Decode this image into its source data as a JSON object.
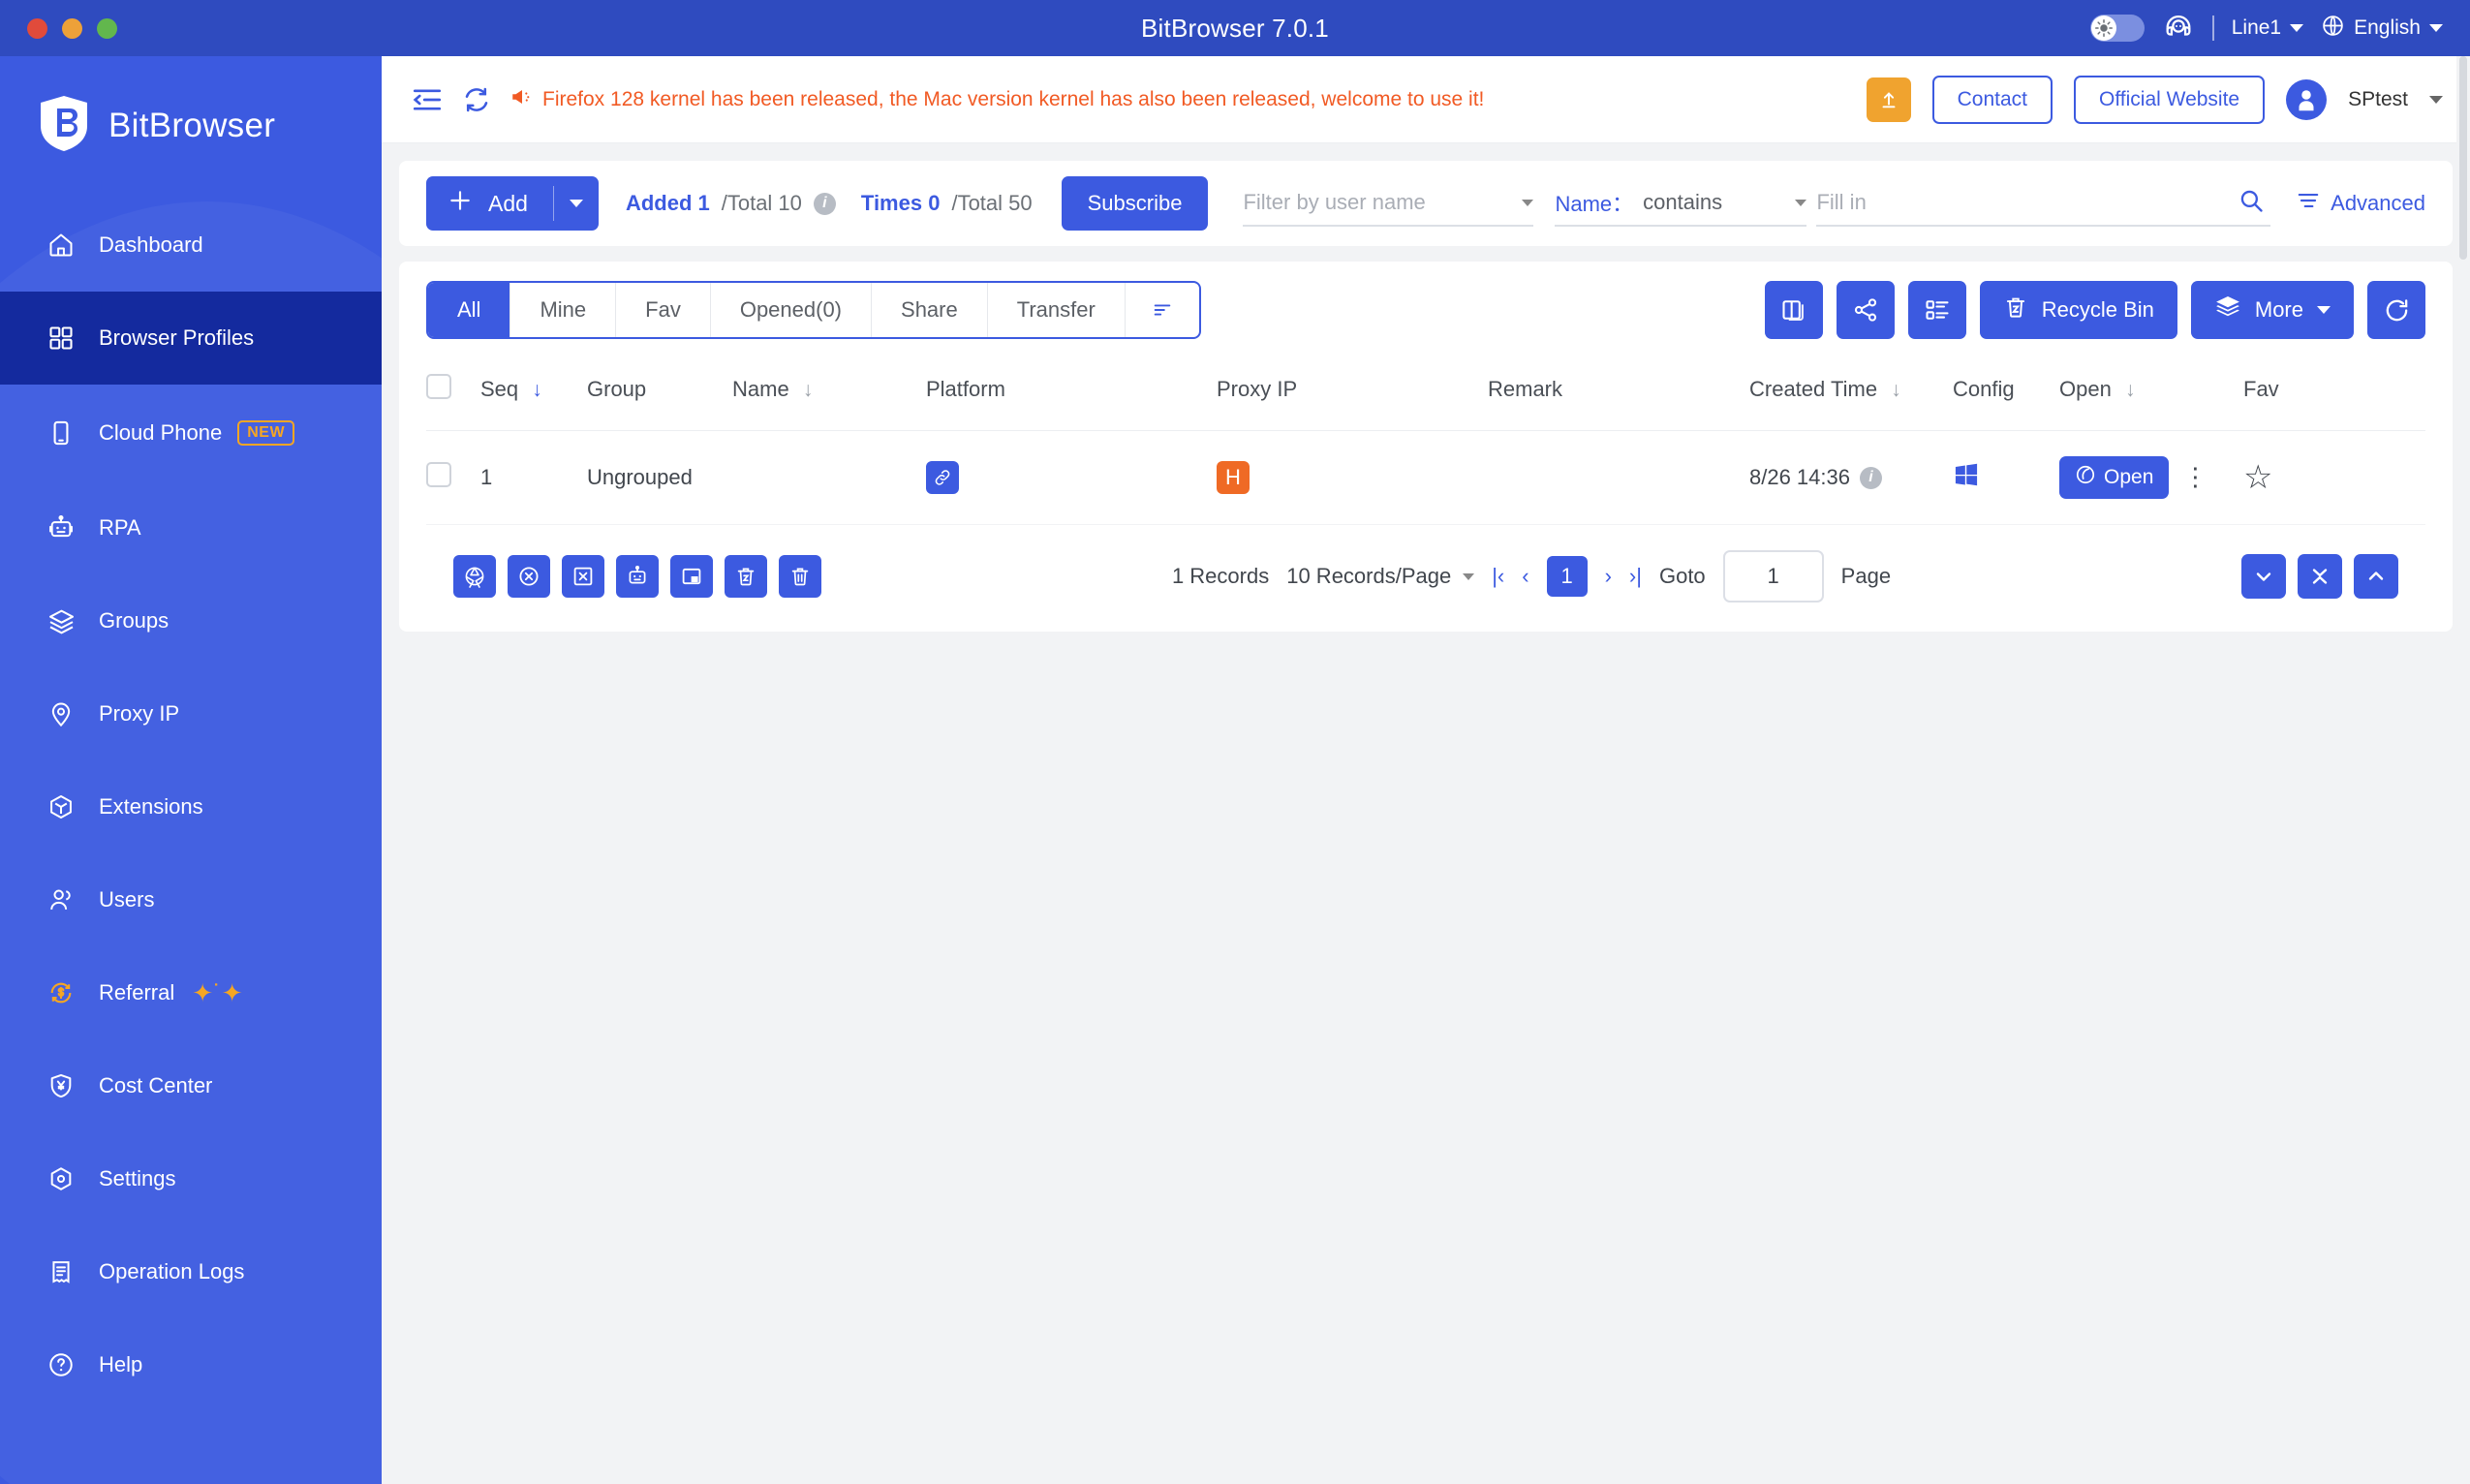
{
  "titlebar": {
    "app_title": "BitBrowser 7.0.1",
    "theme_toggle_icon": "sun-icon",
    "support_icon": "headset-chat-icon",
    "line_label": "Line1",
    "language_icon": "globe-icon",
    "language_label": "English",
    "window_buttons": [
      "close",
      "minimize",
      "maximize"
    ]
  },
  "sidebar": {
    "brand": "BitBrowser",
    "brand_icon": "bitbrowser-shield-logo",
    "items": [
      {
        "label": "Dashboard",
        "icon": "home-icon",
        "active": false
      },
      {
        "label": "Browser Profiles",
        "icon": "grid-icon",
        "active": true
      },
      {
        "label": "Cloud Phone",
        "icon": "mobile-phone-icon",
        "active": false,
        "badge": "NEW"
      },
      {
        "label": "RPA",
        "icon": "robot-icon",
        "active": false
      },
      {
        "label": "Groups",
        "icon": "layers-icon",
        "active": false
      },
      {
        "label": "Proxy IP",
        "icon": "location-pin-icon",
        "active": false
      },
      {
        "label": "Extensions",
        "icon": "hexagon-box-icon",
        "active": false
      },
      {
        "label": "Users",
        "icon": "user-group-icon",
        "active": false
      },
      {
        "label": "Referral",
        "icon": "dollar-refresh-icon",
        "active": false,
        "sparkle": true
      },
      {
        "label": "Cost Center",
        "icon": "shield-yen-icon",
        "active": false
      },
      {
        "label": "Settings",
        "icon": "hex-gear-icon",
        "active": false
      },
      {
        "label": "Operation Logs",
        "icon": "log-list-icon",
        "active": false
      },
      {
        "label": "Help",
        "icon": "question-circle-icon",
        "active": false
      }
    ]
  },
  "notice": {
    "collapse_icon": "collapse-sidebar-icon",
    "refresh_icon": "refresh-icon",
    "megaphone_icon": "megaphone-icon",
    "message": "Firefox 128 kernel has been released, the Mac version kernel has also been released, welcome to use it!",
    "upload_icon": "upload-icon",
    "contact_label": "Contact",
    "official_website_label": "Official Website",
    "avatar_icon": "user-avatar-icon",
    "user_name": "SPtest"
  },
  "toolbar": {
    "add_label": "Add",
    "add_icon": "plus-icon",
    "added_prefix": "Added 1",
    "added_suffix": "/Total 10",
    "times_prefix": "Times 0",
    "times_suffix": "/Total 50",
    "info_icon": "info-icon",
    "subscribe_label": "Subscribe",
    "user_filter_placeholder": "Filter by user name",
    "name_label": "Name：",
    "name_condition": "contains",
    "name_value_placeholder": "Fill in",
    "search_icon": "search-icon",
    "advanced_label": "Advanced",
    "advanced_icon": "filter-icon"
  },
  "tabs": [
    {
      "label": "All",
      "active": true
    },
    {
      "label": "Mine",
      "active": false
    },
    {
      "label": "Fav",
      "active": false
    },
    {
      "label": "Opened(0)",
      "active": false
    },
    {
      "label": "Share",
      "active": false
    },
    {
      "label": "Transfer",
      "active": false
    }
  ],
  "tab_sort_icon": "sort-icon",
  "actions": {
    "window_layout_icon": "window-layout-icon",
    "share_icon": "share-icon",
    "column_settings_icon": "list-settings-icon",
    "recycle_bin_label": "Recycle Bin",
    "recycle_bin_icon": "trash-restore-icon",
    "more_label": "More",
    "more_icon": "layers-icon",
    "refresh_icon": "refresh-circle-icon"
  },
  "table": {
    "columns": [
      {
        "label": "Seq",
        "sortable": true,
        "sort_active": true
      },
      {
        "label": "Group",
        "sortable": false
      },
      {
        "label": "Name",
        "sortable": true
      },
      {
        "label": "Platform",
        "sortable": false
      },
      {
        "label": "Proxy IP",
        "sortable": false
      },
      {
        "label": "Remark",
        "sortable": false
      },
      {
        "label": "Created Time",
        "sortable": true
      },
      {
        "label": "Config",
        "sortable": false
      },
      {
        "label": "Open",
        "sortable": true
      },
      {
        "label": "Fav",
        "sortable": false
      }
    ],
    "rows": [
      {
        "seq": "1",
        "group": "Ungrouped",
        "name": "",
        "platform_icon": "link-icon",
        "proxy_ip_badge": "H",
        "remark": "",
        "created_time": "8/26 14:36",
        "created_time_info_icon": "info-icon",
        "config_icon": "windows-icon",
        "open_label": "Open",
        "open_icon": "bit-browser-icon",
        "more_icon": "kebab-menu-icon",
        "fav_icon": "star-outline-icon"
      }
    ]
  },
  "footer": {
    "mini_buttons": [
      "fingerprint-icon",
      "close-circle-icon",
      "close-box-icon",
      "robot-icon",
      "window-restore-icon",
      "trash-restore-icon",
      "trash-delete-icon"
    ],
    "records_total": "1 Records",
    "page_size": "10 Records/Page",
    "first_page_icon": "first-page-icon",
    "prev_page_icon": "prev-page-icon",
    "current_page": "1",
    "next_page_icon": "next-page-icon",
    "last_page_icon": "last-page-icon",
    "goto_label": "Goto",
    "goto_value": "1",
    "page_label": "Page",
    "scroll_down_icon": "chevron-down-icon",
    "scroll_collapse_icon": "chevron-collapse-icon",
    "scroll_up_icon": "chevron-up-icon"
  },
  "colors": {
    "brand_blue": "#3c5ae0",
    "title_blue": "#2f4bbf",
    "active_nav": "#142a9e",
    "orange": "#f15a24",
    "badge_orange": "#f5a623",
    "proxy_badge": "#ef6a25"
  }
}
